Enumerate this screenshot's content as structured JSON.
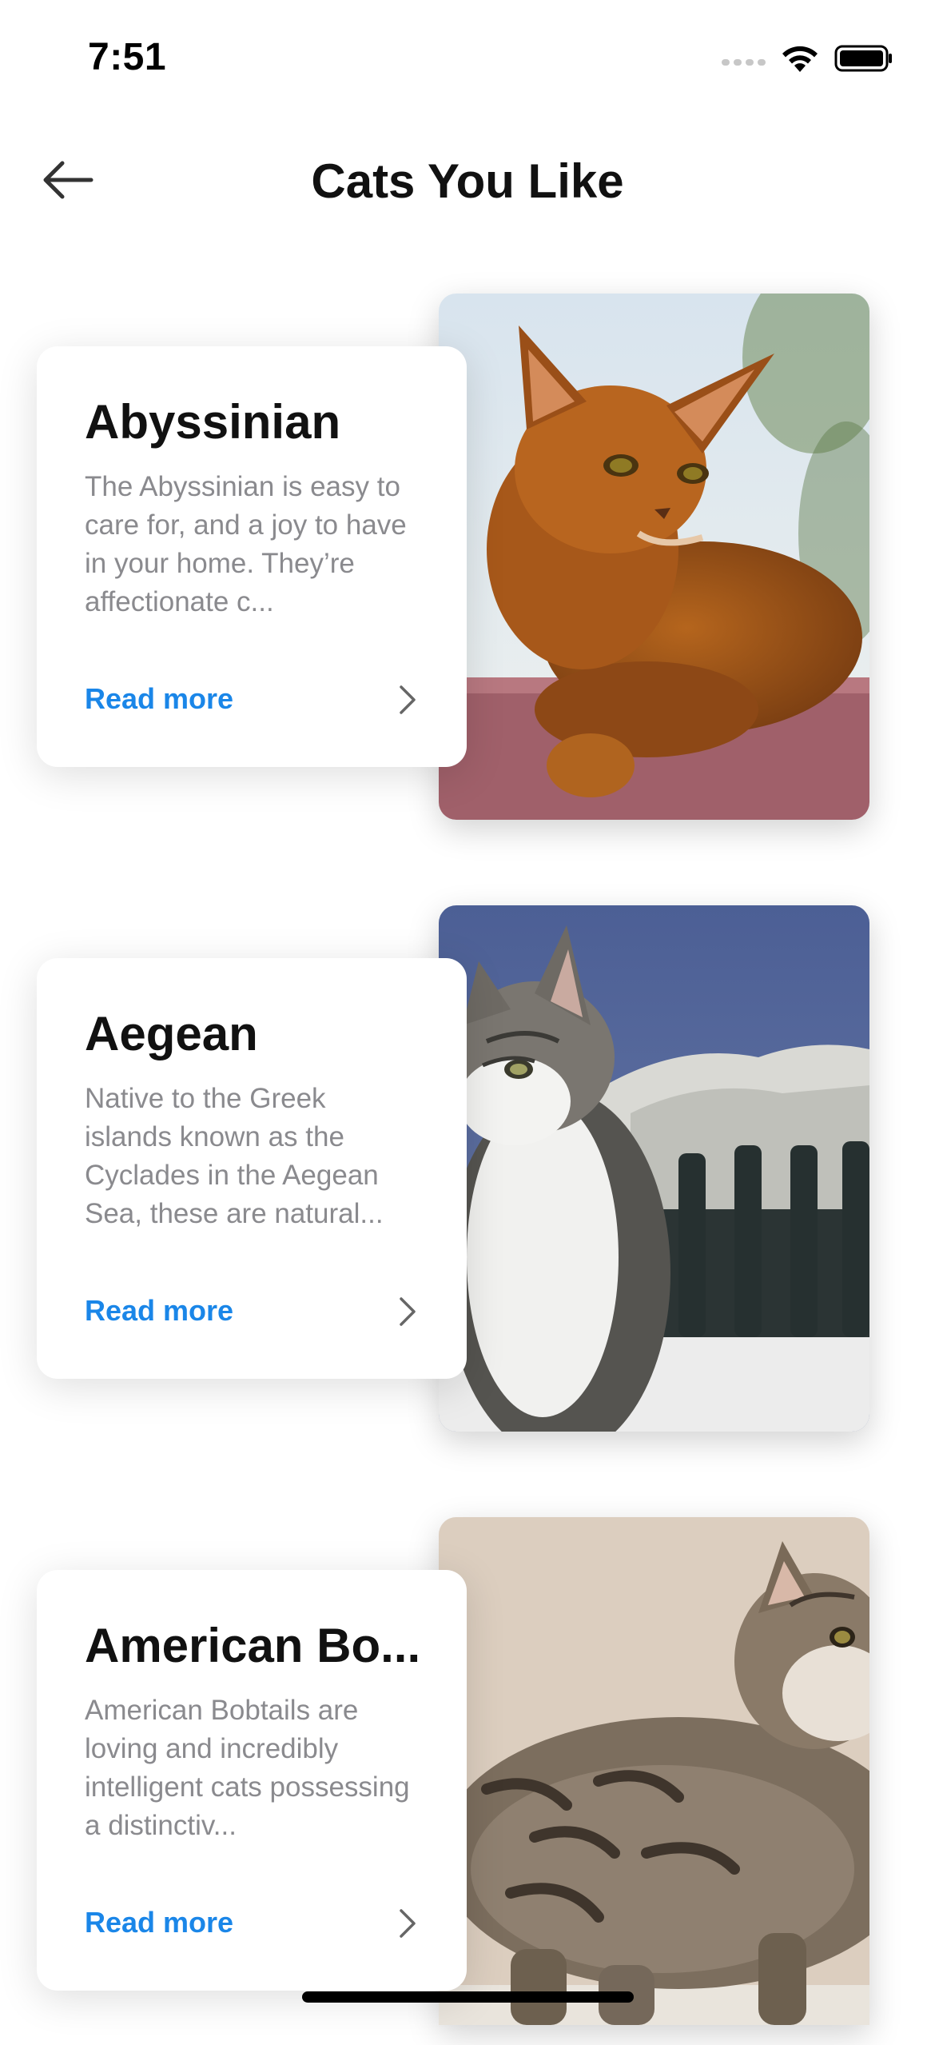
{
  "status_bar": {
    "time": "7:51",
    "icons": [
      "signal-icon",
      "wifi-icon",
      "battery-icon"
    ]
  },
  "nav": {
    "title": "Cats You Like",
    "back_icon": "arrow-left-icon"
  },
  "breeds": [
    {
      "name": "Abyssinian",
      "description": "The Abyssinian is easy to care for, and a joy to have in your home. They’re affectionate c...",
      "read_more": "Read more",
      "chevron_icon": "chevron-right-icon",
      "image": "abyssinian-cat-photo"
    },
    {
      "name": "Aegean",
      "description": "Native to the Greek islands known as the Cyclades in the Aegean Sea, these are natural...",
      "read_more": "Read more",
      "chevron_icon": "chevron-right-icon",
      "image": "aegean-cat-photo"
    },
    {
      "name": "American Bo...",
      "description": "American Bobtails are loving and incredibly intelligent cats possessing a distinctiv...",
      "read_more": "Read more",
      "chevron_icon": "chevron-right-icon",
      "image": "american-bobtail-cat-photo"
    }
  ],
  "colors": {
    "link": "#1a86e8",
    "description": "#8a8a8e",
    "title": "#111111",
    "background": "#ffffff"
  }
}
